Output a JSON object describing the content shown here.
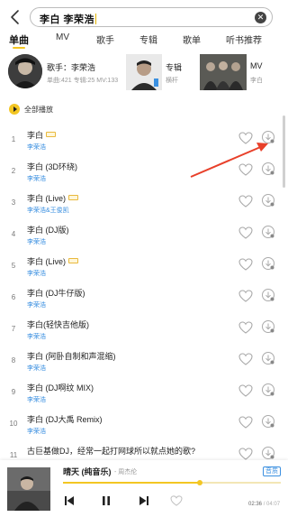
{
  "search": {
    "query": "李白  李荣浩",
    "clear_icon": "close-icon"
  },
  "tabs": [
    "单曲",
    "MV",
    "歌手",
    "专辑",
    "歌单",
    "听书推荐"
  ],
  "top_results": {
    "singer": {
      "title": "歌手：李荣浩",
      "meta": "单曲:421  专辑:25 MV:133"
    },
    "album": {
      "title": "专辑",
      "meta": "横杆"
    },
    "mv": {
      "title": "MV",
      "meta": "李白"
    }
  },
  "play_all_label": "全部播放",
  "songs": [
    {
      "num": "1",
      "title": "李白",
      "artist": "李荣浩",
      "vip": true
    },
    {
      "num": "2",
      "title": "李白 (3D环绕)",
      "artist": "李荣浩",
      "vip": false
    },
    {
      "num": "3",
      "title": "李白 (Live)",
      "artist": "李荣浩&王俊凯",
      "vip": true
    },
    {
      "num": "4",
      "title": "李白 (DJ版)",
      "artist": "李荣浩",
      "vip": false
    },
    {
      "num": "5",
      "title": "李白 (Live)",
      "artist": "李荣浩",
      "vip": true
    },
    {
      "num": "6",
      "title": "李白 (DJ牛仔版)",
      "artist": "李荣浩",
      "vip": false
    },
    {
      "num": "7",
      "title": "李白(轻快吉他版)",
      "artist": "李荣浩",
      "vip": false
    },
    {
      "num": "8",
      "title": "李白 (阿卧自制和声混缩)",
      "artist": "李荣浩",
      "vip": false
    },
    {
      "num": "9",
      "title": "李白 (DJ啊纹 MIX)",
      "artist": "李荣浩",
      "vip": false
    },
    {
      "num": "10",
      "title": "李白 (DJ大禹 Remix)",
      "artist": "李荣浩",
      "vip": false
    },
    {
      "num": "11",
      "title": "古巨基做DJ，经常一起打网球所以就点她的歌?",
      "artist": "",
      "vip": false
    }
  ],
  "player": {
    "title": "晴天 (纯音乐)",
    "artist": "- 周杰伦",
    "quality": "音质",
    "elapsed": "02:36",
    "total": "/ 04:07",
    "progress_fraction": 0.63
  },
  "colors": {
    "accent": "#f3c623",
    "link": "#3a8fe0",
    "annotation": "#e8402a"
  }
}
